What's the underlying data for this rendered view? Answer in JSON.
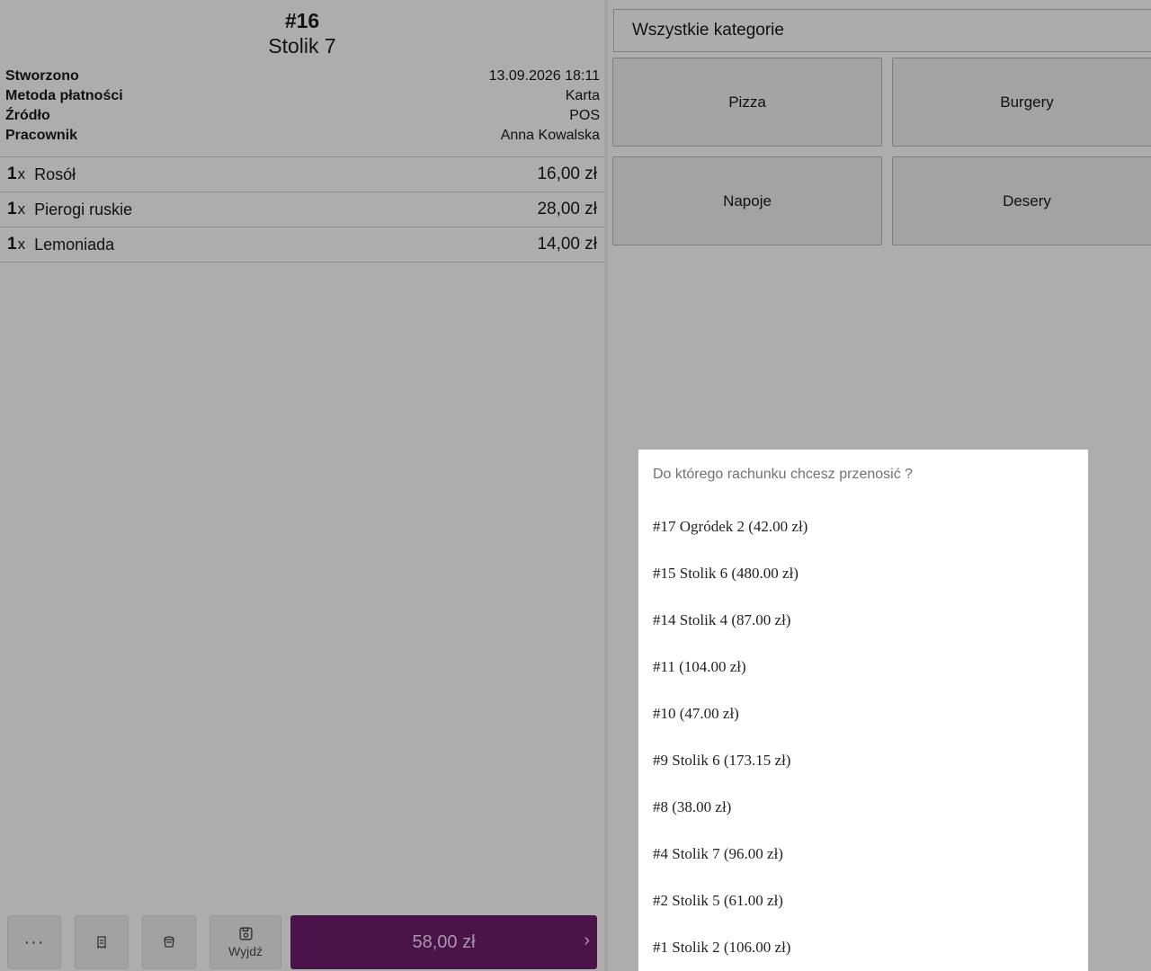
{
  "order": {
    "number": "#16",
    "table": "Stolik 7",
    "meta": [
      {
        "label": "Stworzono",
        "value": "13.09.2026 18:11"
      },
      {
        "label": "Metoda płatności",
        "value": "Karta"
      },
      {
        "label": "Źródło",
        "value": "POS"
      },
      {
        "label": "Pracownik",
        "value": "Anna Kowalska"
      }
    ],
    "items": [
      {
        "qty": "1",
        "x": "x",
        "name": "Rosół",
        "price": "16,00 zł"
      },
      {
        "qty": "1",
        "x": "x",
        "name": "Pierogi ruskie",
        "price": "28,00 zł"
      },
      {
        "qty": "1",
        "x": "x",
        "name": "Lemoniada",
        "price": "14,00 zł"
      }
    ]
  },
  "actions": {
    "more_label": "···",
    "receipt_icon": "receipt-icon",
    "cup_icon": "cup-icon",
    "save_icon": "save-icon",
    "save_label": "Wyjdź",
    "pay_total": "58,00 zł",
    "pay_chevron": "›",
    "pay_color": "#4a1349"
  },
  "categories": {
    "all_label": "Wszystkie kategorie",
    "tiles": [
      "Pizza",
      "Burgery",
      "Napoje",
      "Desery"
    ]
  },
  "transfer_modal": {
    "title": "Do którego rachunku chcesz przenosić ?",
    "options": [
      "#17 Ogródek 2 (42.00 zł)",
      "#15 Stolik 6 (480.00 zł)",
      "#14 Stolik 4 (87.00 zł)",
      "#11 (104.00 zł)",
      "#10 (47.00 zł)",
      "#9 Stolik 6 (173.15 zł)",
      "#8 (38.00 zł)",
      "#4 Stolik 7 (96.00 zł)",
      "#2 Stolik 5 (61.00 zł)",
      "#1 Stolik 2 (106.00 zł)"
    ]
  }
}
